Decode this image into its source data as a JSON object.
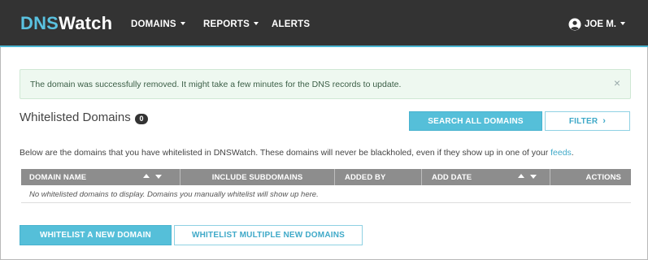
{
  "header": {
    "brand_main": "DNS",
    "brand_rest": "Watch",
    "nav": [
      {
        "label": "DOMAINS",
        "has_caret": true
      },
      {
        "label": "REPORTS",
        "has_caret": true
      },
      {
        "label": "ALERTS",
        "has_caret": false
      }
    ],
    "user_label": "JOE M.",
    "user_icon": "user-circle-icon"
  },
  "alert": {
    "message": "The domain was successfully removed. It might take a few minutes for the DNS records to update.",
    "close_glyph": "×"
  },
  "section": {
    "title": "Whitelisted Domains",
    "count": "0",
    "search_button": "SEARCH ALL DOMAINS",
    "filter_button": "FILTER",
    "filter_chevron": "›",
    "description_before": "Below are the domains that you have whitelisted in DNSWatch. These domains will never be blackholed, even if they show up in one of your ",
    "description_link": "feeds",
    "description_after": "."
  },
  "table": {
    "columns": [
      "DOMAIN NAME",
      "INCLUDE SUBDOMAINS",
      "ADDED BY",
      "ADD DATE",
      "ACTIONS"
    ],
    "empty_message": "No whitelisted domains to display. Domains you manually whitelist will show up here."
  },
  "footer_buttons": {
    "whitelist_one": "WHITELIST A NEW DOMAIN",
    "whitelist_multiple": "WHITELIST MULTIPLE NEW DOMAINS"
  },
  "colors": {
    "header_bg": "#333333",
    "accent": "#55bfd9",
    "alert_bg": "#eef8f0",
    "table_header_bg": "#8d8d8d"
  }
}
